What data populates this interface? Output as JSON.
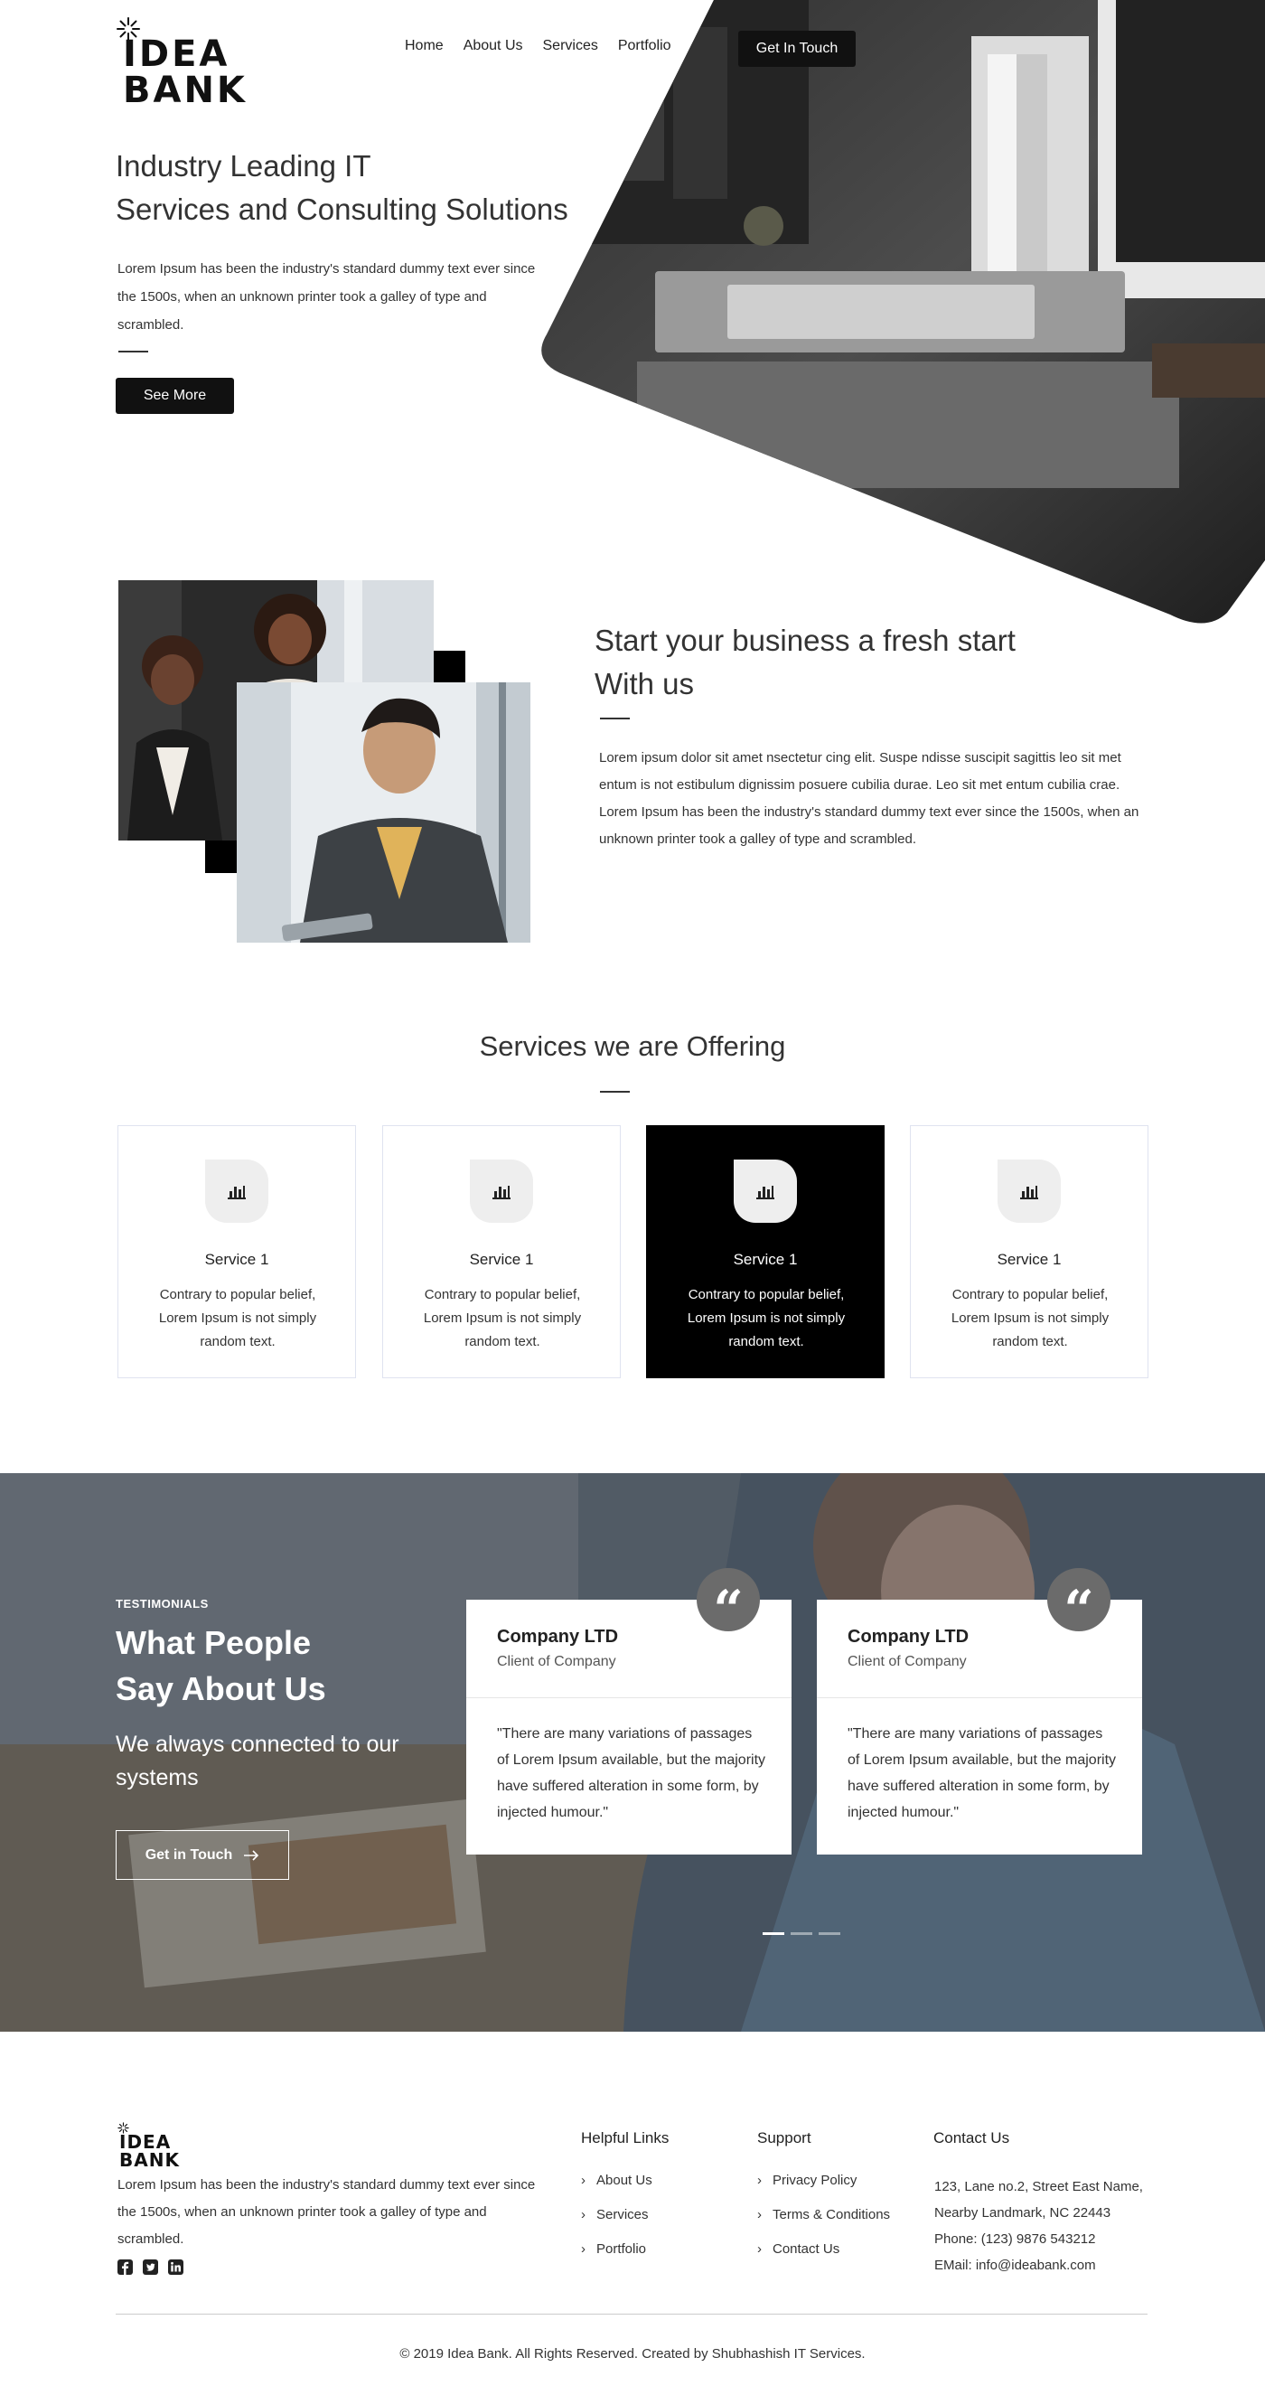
{
  "header": {
    "logo_text": "IDEA BANK",
    "nav": [
      "Home",
      "About Us",
      "Services",
      "Portfolio"
    ],
    "cta_label": "Get In Touch"
  },
  "hero": {
    "title_line1": "Industry Leading IT",
    "title_line2": "Services and Consulting Solutions",
    "text": "Lorem Ipsum has been the industry's standard dummy text ever since the 1500s, when an unknown printer took a galley of type and scrambled.",
    "button": "See More"
  },
  "about": {
    "title_line1": "Start your business a fresh start",
    "title_line2": "With us",
    "para1": "Lorem ipsum dolor sit amet nsectetur cing elit. Suspe ndisse suscipit sagittis leo sit met entum is not estibulum dignissim posuere cubilia durae. Leo sit met entum cubilia crae.",
    "para2": "Lorem Ipsum has been the industry's standard dummy text ever since the 1500s, when an unknown printer took a galley of type and scrambled."
  },
  "services": {
    "title": "Services we are Offering",
    "cards": [
      {
        "name": "Service 1",
        "desc": "Contrary to popular belief, Lorem Ipsum is not simply random text.",
        "icon": "bar-chart-icon"
      },
      {
        "name": "Service 1",
        "desc": "Contrary to popular belief, Lorem Ipsum is not simply random text.",
        "icon": "bar-chart-icon"
      },
      {
        "name": "Service 1",
        "desc": "Contrary to popular belief, Lorem Ipsum is not simply random text.",
        "icon": "bar-chart-icon"
      },
      {
        "name": "Service 1",
        "desc": "Contrary to popular belief, Lorem Ipsum is not simply random text.",
        "icon": "bar-chart-icon"
      }
    ],
    "active_index": 2
  },
  "testimonials": {
    "eyebrow": "TESTIMONIALS",
    "title_line1": "What People",
    "title_line2": "Say About Us",
    "subtitle": "We always connected to our systems",
    "button": "Get in Touch",
    "items": [
      {
        "company": "Company LTD",
        "role": "Client of Company",
        "quote": "\"There are many variations of passages of Lorem Ipsum available, but the majority have suffered alteration in some form, by injected humour.\""
      },
      {
        "company": "Company LTD",
        "role": "Client of Company",
        "quote": "\"There are many variations of passages of Lorem Ipsum available, but the majority have suffered alteration in some form, by injected humour.\""
      }
    ],
    "quote_mark": "“",
    "slides": 3,
    "active_slide": 0
  },
  "footer": {
    "logo_text": "IDEA BANK",
    "about": "Lorem Ipsum has been the industry's standard dummy text ever since the 1500s, when an unknown printer took a galley of type and scrambled.",
    "social": [
      "facebook-icon",
      "twitter-icon",
      "linkedin-icon"
    ],
    "helpful_title": "Helpful Links",
    "helpful": [
      "About Us",
      "Services",
      "Portfolio"
    ],
    "support_title": "Support",
    "support": [
      "Privacy Policy",
      "Terms & Conditions",
      "Contact Us"
    ],
    "contact_title": "Contact Us",
    "address_line1": "123, Lane no.2, Street East Name,",
    "address_line2": "Nearby Landmark, NC 22443",
    "phone": "Phone: (123) 9876 543212",
    "email": "EMail: info@ideabank.com",
    "copyright": "© 2019 Idea Bank. All Rights Reserved. Created by Shubhashish IT Services."
  },
  "colors": {
    "accent": "#000000",
    "card_border": "#dfe3f0",
    "icon_bg": "#eeeeee"
  }
}
